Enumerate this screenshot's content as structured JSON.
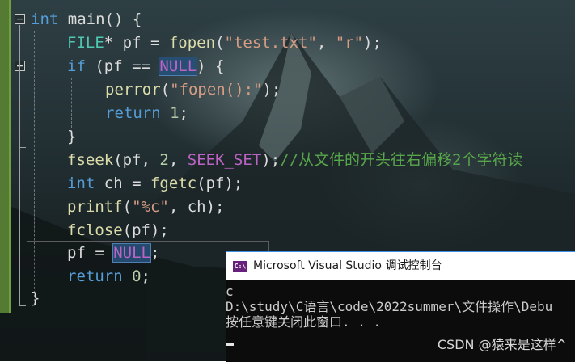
{
  "editor": {
    "code": {
      "l1_kw": "int",
      "l1_rest": " main() {",
      "l2_type": "FILE",
      "l2_a": "* pf = ",
      "l2_fn": "fopen",
      "l2_b": "(",
      "l2_s1": "\"test.txt\"",
      "l2_c": ", ",
      "l2_s2": "\"r\"",
      "l2_d": ");",
      "l3_kw": "if",
      "l3_a": " (pf == ",
      "l3_null": "NULL",
      "l3_b": ") {",
      "l4_fn": "perror",
      "l4_a": "(",
      "l4_s": "\"fopen():\"",
      "l4_b": ");",
      "l5_kw": "return",
      "l5_a": " ",
      "l5_num": "1",
      "l5_b": ";",
      "l6": "}",
      "l7_fn": "fseek",
      "l7_a": "(pf, ",
      "l7_num": "2",
      "l7_b": ", ",
      "l7_mac": "SEEK_SET",
      "l7_c": ");",
      "l7_cmt": "//从文件的开头往右偏移2个字符读",
      "l8_kw": "int",
      "l8_a": " ch = ",
      "l8_fn": "fgetc",
      "l8_b": "(pf);",
      "l9_fn": "printf",
      "l9_a": "(",
      "l9_s": "\"%c\"",
      "l9_b": ", ch);",
      "l10_fn": "fclose",
      "l10_a": "(pf);",
      "l11_a": "pf = ",
      "l11_null": "NULL",
      "l11_b": ";",
      "l12_kw": "return",
      "l12_a": " ",
      "l12_num": "0",
      "l12_b": ";",
      "l13": "}"
    }
  },
  "console": {
    "title": "Microsoft Visual Studio 调试控制台",
    "icon_text": "C:\\",
    "lines": [
      "c",
      "D:\\study\\C语言\\code\\2022summer\\文件操作\\Debu",
      "按任意键关闭此窗口. . ."
    ]
  },
  "watermark": "CSDN @猿来是这样^",
  "icons": {
    "fold_collapse": "minus-box-icon",
    "console": "console-app-icon"
  },
  "colors": {
    "keyword": "#569cd6",
    "type": "#4ec9b0",
    "function": "#dcdcaa",
    "string": "#d69d85",
    "number": "#b5cea8",
    "comment": "#57a64a",
    "macro": "#bd63c5",
    "gutter": "#557a34"
  }
}
